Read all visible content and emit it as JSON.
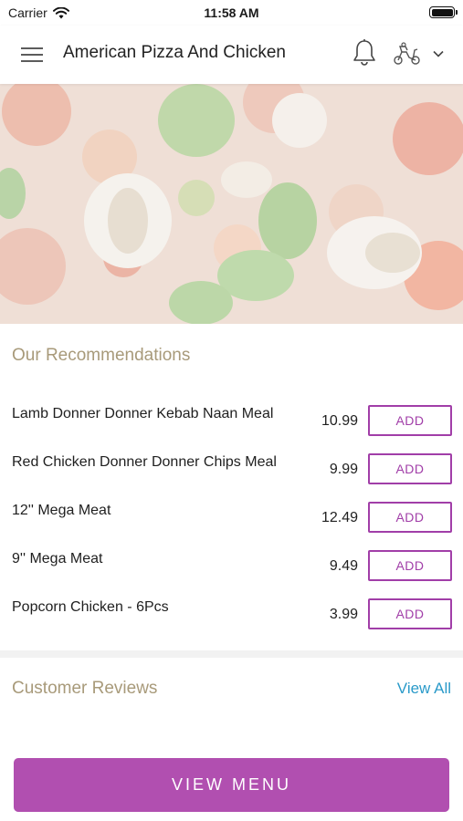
{
  "status_bar": {
    "carrier": "Carrier",
    "time": "11:58 AM"
  },
  "header": {
    "restaurant_name": "American Pizza And Chicken",
    "menu_icon": "hamburger-menu-icon",
    "bell_icon": "bell-icon",
    "mode_icon": "delivery-scooter-icon",
    "chevron_icon": "chevron-down-icon"
  },
  "recommendations": {
    "title": "Our Recommendations",
    "add_label": "ADD",
    "items": [
      {
        "name": "Lamb Donner Donner Kebab Naan Meal",
        "price": "10.99"
      },
      {
        "name": "Red Chicken Donner Donner Chips Meal",
        "price": "9.99"
      },
      {
        "name": "12'' Mega Meat",
        "price": "12.49"
      },
      {
        "name": "9'' Mega Meat",
        "price": "9.49"
      },
      {
        "name": "Popcorn Chicken - 6Pcs",
        "price": "3.99"
      }
    ]
  },
  "reviews": {
    "title": "Customer Reviews",
    "view_all": "View All"
  },
  "footer": {
    "view_menu": "VIEW MENU"
  },
  "colors": {
    "accent": "#b14fb0",
    "add_border": "#a13ea8",
    "section_title": "#a89a7a",
    "link": "#2a9ac9"
  }
}
